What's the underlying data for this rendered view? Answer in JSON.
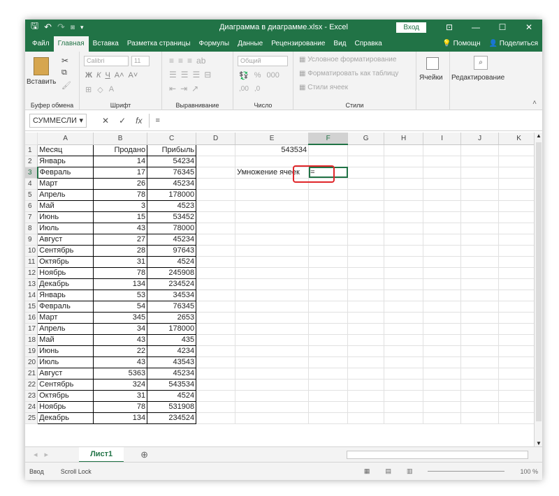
{
  "window": {
    "title": "Диаграмма в диаграмме.xlsx  -  Excel",
    "login_label": "Вход"
  },
  "menu": {
    "tabs": [
      "Файл",
      "Главная",
      "Вставка",
      "Разметка страницы",
      "Формулы",
      "Данные",
      "Рецензирование",
      "Вид",
      "Справка"
    ],
    "active_index": 1,
    "help": "Помощн",
    "share": "Поделиться"
  },
  "ribbon": {
    "clipboard": {
      "paste": "Вставить",
      "group": "Буфер обмена"
    },
    "font": {
      "name": "Calibri",
      "size": "11",
      "group": "Шрифт"
    },
    "align": {
      "group": "Выравнивание"
    },
    "number": {
      "format": "Общий",
      "group": "Число"
    },
    "styles": {
      "cond": "Условное форматирование",
      "table": "Форматировать как таблицу",
      "cell": "Стили ячеек",
      "group": "Стили"
    },
    "cells": {
      "label": "Ячейки"
    },
    "editing": {
      "label": "Редактирование"
    }
  },
  "formula_bar": {
    "name_box": "СУММЕСЛИ",
    "content": "="
  },
  "sheet": {
    "columns": [
      "A",
      "B",
      "C",
      "D",
      "E",
      "F",
      "G",
      "H",
      "I",
      "J",
      "K"
    ],
    "selected_column": "F",
    "selected_row": 3,
    "rows": [
      {
        "n": "1",
        "a": "Месяц",
        "b": "Продано",
        "c": "Прибыль",
        "e": "543534",
        "f": ""
      },
      {
        "n": "2",
        "a": "Январь",
        "b": "14",
        "c": "54234",
        "e": "",
        "f": ""
      },
      {
        "n": "3",
        "a": "Февраль",
        "b": "17",
        "c": "76345",
        "e": "Умножение ячеек",
        "f": "="
      },
      {
        "n": "4",
        "a": "Март",
        "b": "26",
        "c": "45234",
        "e": "",
        "f": ""
      },
      {
        "n": "5",
        "a": "Апрель",
        "b": "78",
        "c": "178000",
        "e": "",
        "f": ""
      },
      {
        "n": "6",
        "a": "Май",
        "b": "3",
        "c": "4523",
        "e": "",
        "f": ""
      },
      {
        "n": "7",
        "a": "Июнь",
        "b": "15",
        "c": "53452",
        "e": "",
        "f": ""
      },
      {
        "n": "8",
        "a": "Июль",
        "b": "43",
        "c": "78000",
        "e": "",
        "f": ""
      },
      {
        "n": "9",
        "a": "Август",
        "b": "27",
        "c": "45234",
        "e": "",
        "f": ""
      },
      {
        "n": "10",
        "a": "Сентябрь",
        "b": "28",
        "c": "97643",
        "e": "",
        "f": ""
      },
      {
        "n": "11",
        "a": "Октябрь",
        "b": "31",
        "c": "4524",
        "e": "",
        "f": ""
      },
      {
        "n": "12",
        "a": "Ноябрь",
        "b": "78",
        "c": "245908",
        "e": "",
        "f": ""
      },
      {
        "n": "13",
        "a": "Декабрь",
        "b": "134",
        "c": "234524",
        "e": "",
        "f": ""
      },
      {
        "n": "14",
        "a": "Январь",
        "b": "53",
        "c": "34534",
        "e": "",
        "f": ""
      },
      {
        "n": "15",
        "a": "Февраль",
        "b": "54",
        "c": "76345",
        "e": "",
        "f": ""
      },
      {
        "n": "16",
        "a": "Март",
        "b": "345",
        "c": "2653",
        "e": "",
        "f": ""
      },
      {
        "n": "17",
        "a": "Апрель",
        "b": "34",
        "c": "178000",
        "e": "",
        "f": ""
      },
      {
        "n": "18",
        "a": "Май",
        "b": "43",
        "c": "435",
        "e": "",
        "f": ""
      },
      {
        "n": "19",
        "a": "Июнь",
        "b": "22",
        "c": "4234",
        "e": "",
        "f": ""
      },
      {
        "n": "20",
        "a": "Июль",
        "b": "43",
        "c": "43543",
        "e": "",
        "f": ""
      },
      {
        "n": "21",
        "a": "Август",
        "b": "5363",
        "c": "45234",
        "e": "",
        "f": ""
      },
      {
        "n": "22",
        "a": "Сентябрь",
        "b": "324",
        "c": "543534",
        "e": "",
        "f": ""
      },
      {
        "n": "23",
        "a": "Октябрь",
        "b": "31",
        "c": "4524",
        "e": "",
        "f": ""
      },
      {
        "n": "24",
        "a": "Ноябрь",
        "b": "78",
        "c": "531908",
        "e": "",
        "f": ""
      },
      {
        "n": "25",
        "a": "Декабрь",
        "b": "134",
        "c": "234524",
        "e": "",
        "f": ""
      }
    ]
  },
  "sheet_tabs": {
    "active": "Лист1"
  },
  "status": {
    "mode": "Ввод",
    "scroll_lock": "Scroll Lock",
    "zoom": "100 %"
  },
  "colors": {
    "excel_green": "#217346",
    "highlight_red": "#e0262a"
  }
}
